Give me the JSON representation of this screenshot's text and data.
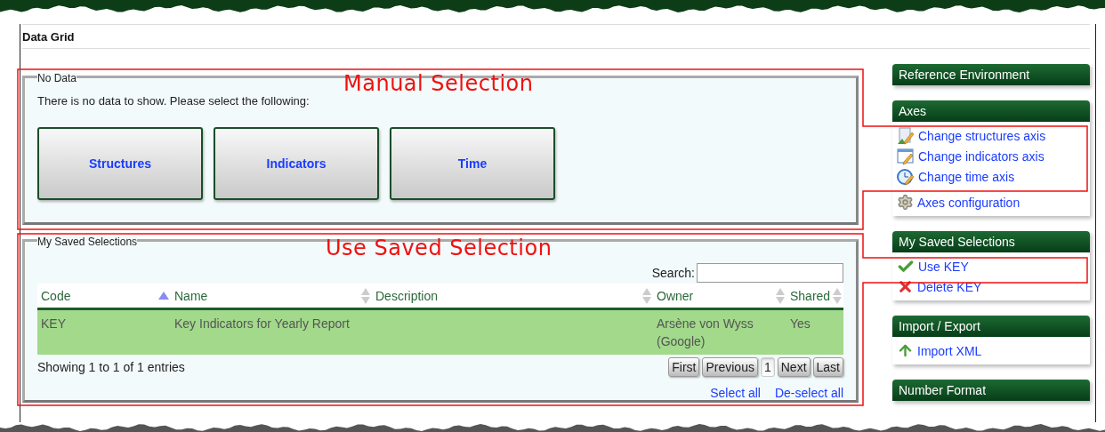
{
  "page_title": "Data Grid",
  "annotations": [
    {
      "label": "Manual Selection"
    },
    {
      "label": "Use Saved Selection"
    }
  ],
  "no_data": {
    "legend": "No Data",
    "message": "There is no data to show. Please select the following:",
    "buttons": [
      "Structures",
      "Indicators",
      "Time"
    ]
  },
  "saved_selections": {
    "legend": "My Saved Selections",
    "search_label": "Search:",
    "columns": [
      {
        "label": "Code",
        "sorted": true
      },
      {
        "label": "Name",
        "sorted": false
      },
      {
        "label": "Description",
        "sorted": false
      },
      {
        "label": "Owner",
        "sorted": false
      },
      {
        "label": "Shared",
        "sorted": false
      }
    ],
    "rows": [
      {
        "cells": [
          "KEY",
          "Key Indicators for Yearly Report",
          "",
          "Arsène von Wyss (Google)",
          "Yes"
        ],
        "selected": true
      }
    ],
    "info": "Showing 1 to 1 of 1 entries",
    "pager": [
      {
        "label": "First",
        "selected": false
      },
      {
        "label": "Previous",
        "selected": false
      },
      {
        "label": "1",
        "selected": true
      },
      {
        "label": "Next",
        "selected": false
      },
      {
        "label": "Last",
        "selected": false
      }
    ],
    "links": [
      "Select all",
      "De-select all"
    ]
  },
  "sidebar": [
    {
      "title": "Reference Environment"
    },
    {
      "title": "Axes",
      "items": [
        {
          "label": "Change structures axis",
          "kind": "structures"
        },
        {
          "label": "Change indicators axis",
          "kind": "indicators"
        },
        {
          "label": "Change time axis",
          "kind": "time"
        },
        {
          "label": "Axes configuration",
          "kind": "config"
        }
      ]
    },
    {
      "title": "My Saved Selections",
      "items": [
        {
          "label": "Use KEY",
          "kind": "check"
        },
        {
          "label": "Delete KEY",
          "kind": "cross"
        }
      ]
    },
    {
      "title": "Import / Export",
      "items": [
        {
          "label": "Import XML",
          "kind": "upload"
        }
      ]
    },
    {
      "title": "Number Format"
    }
  ]
}
